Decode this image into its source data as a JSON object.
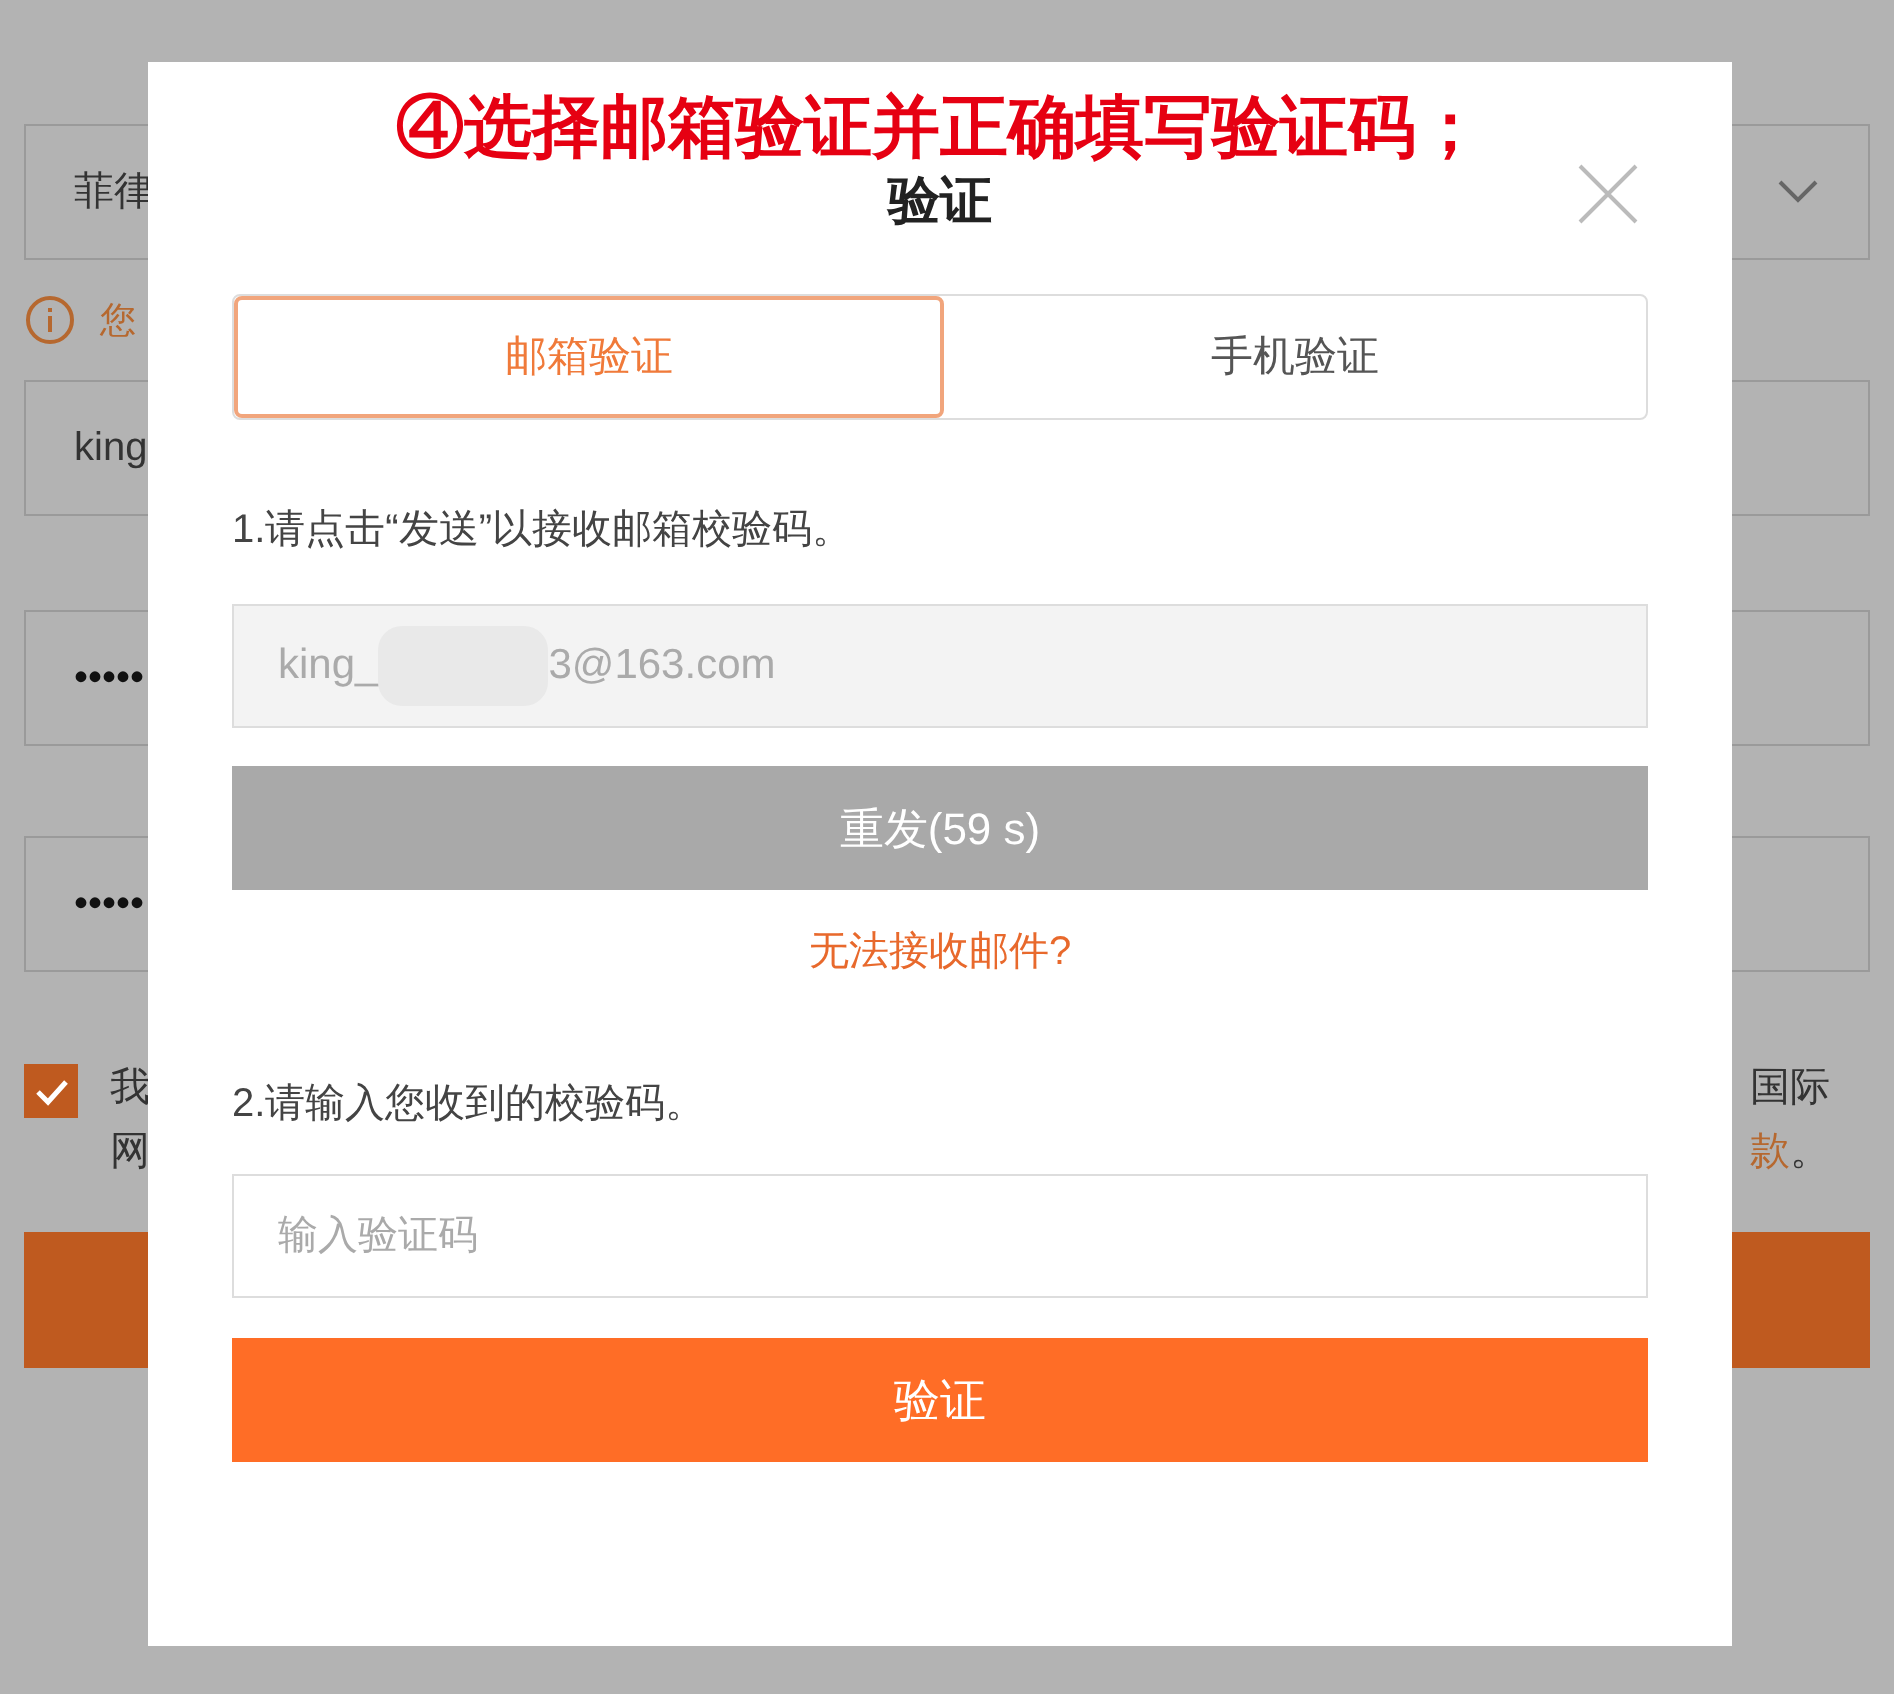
{
  "background_form": {
    "country_select": {
      "value": "菲律"
    },
    "notice": {
      "text": "您"
    },
    "username_field": {
      "value": "king"
    },
    "password_field": {
      "value": "•••••"
    },
    "confirm_password_field": {
      "value": "•••••"
    },
    "agreement": {
      "checked": true,
      "line_1_start": "我",
      "line_1_end": "国际",
      "line_2_start": "网",
      "line_2_end": "款",
      "line_2_tail": "。"
    }
  },
  "annotation": "④选择邮箱验证并正确填写验证码；",
  "dialog": {
    "title": "验证",
    "tabs": [
      {
        "label": "邮箱验证",
        "selected": true
      },
      {
        "label": "手机验证",
        "selected": false
      }
    ],
    "step_1": "1.请点击“发送”以接收邮箱校验码。",
    "email_field": {
      "value_start": "king_",
      "value_end": "3@163.com"
    },
    "resend_button": {
      "label": "重发(59 s)",
      "disabled": true
    },
    "help_link": "无法接收邮件?",
    "step_2": "2.请输入您收到的校验码。",
    "code_field": {
      "placeholder": "输入验证码"
    },
    "verify_button": "验证"
  }
}
